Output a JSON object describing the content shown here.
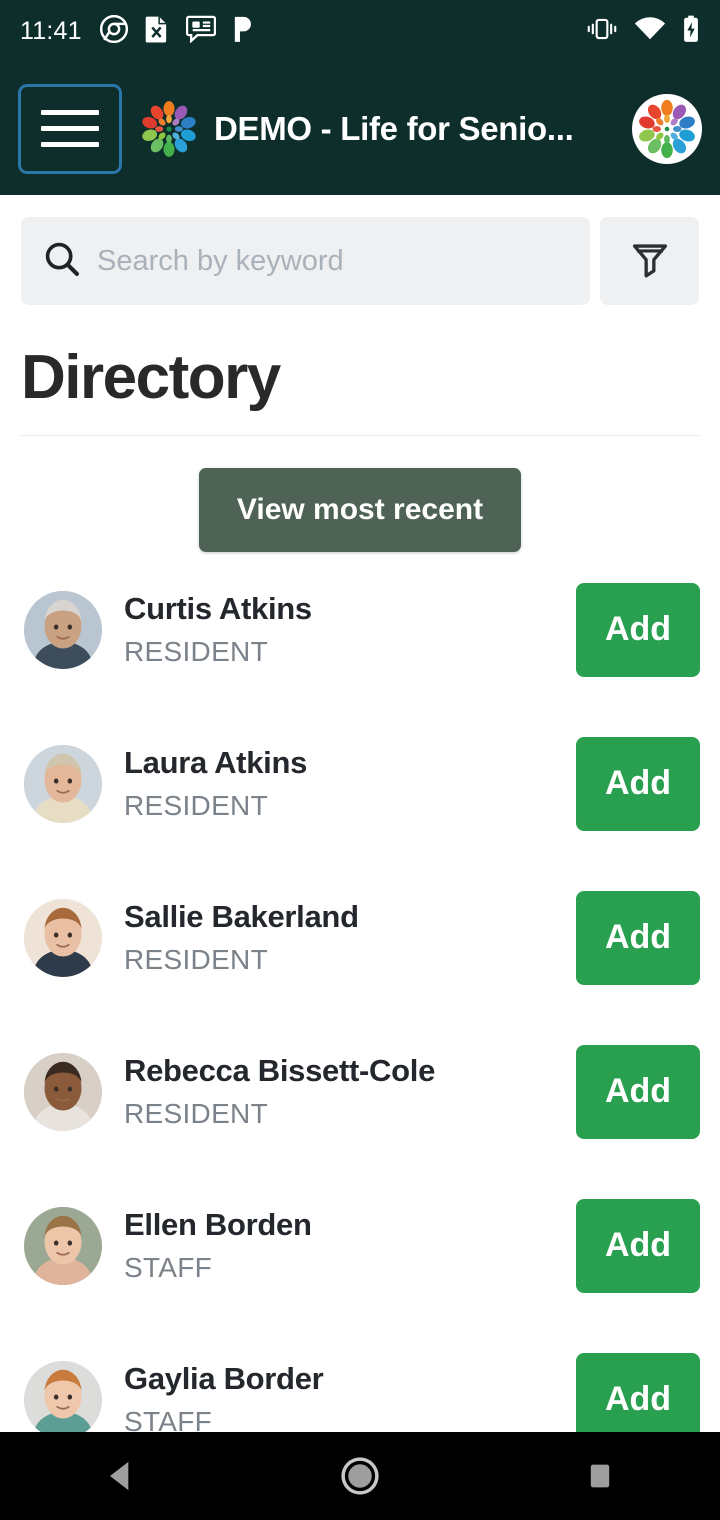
{
  "status_bar": {
    "clock": "11:41",
    "left_icons": [
      "chrome-icon",
      "spreadsheet-icon",
      "message-icon",
      "pandora-icon"
    ],
    "right_icons": [
      "vibrate-icon",
      "wifi-icon",
      "battery-charging-icon"
    ],
    "background_color": "#0d2e2b"
  },
  "app_bar": {
    "menu_label": "Open navigation menu",
    "title": "DEMO - Life for Senio...",
    "logo_name": "app-logo",
    "avatar_name": "user-avatar",
    "focus_ring_color": "#2b76a8",
    "background_color": "#0d2e2b"
  },
  "search": {
    "placeholder": "Search by keyword",
    "value": "",
    "icon": "search-icon",
    "filter_icon": "filter-funnel-icon",
    "field_background": "#eef0f1"
  },
  "page": {
    "title": "Directory"
  },
  "actions": {
    "view_most_recent": "View most recent",
    "view_most_recent_color": "#4e6355",
    "add_label": "Add",
    "add_color": "#28a04f"
  },
  "directory": [
    {
      "name": "Curtis Atkins",
      "role": "RESIDENT",
      "action": "Add",
      "avatar": "photo-curtis-atkins",
      "avatar_bg": "#b9c6d2",
      "skin": "#c9a183",
      "hair": "#d8d5d0",
      "shirt": "#3d4d5c"
    },
    {
      "name": "Laura Atkins",
      "role": "RESIDENT",
      "action": "Add",
      "avatar": "photo-laura-atkins",
      "avatar_bg": "#cdd6dc",
      "skin": "#e3b79a",
      "hair": "#cfc6ad",
      "shirt": "#e7dcc4"
    },
    {
      "name": "Sallie Bakerland",
      "role": "RESIDENT",
      "action": "Add",
      "avatar": "photo-sallie-bakerland",
      "avatar_bg": "#efe2d6",
      "skin": "#e9c0a4",
      "hair": "#a86a3c",
      "shirt": "#2d3b4a"
    },
    {
      "name": "Rebecca Bissett-Cole",
      "role": "RESIDENT",
      "action": "Add",
      "avatar": "photo-rebecca-bissett-cole",
      "avatar_bg": "#d8cfc6",
      "skin": "#8a5a3b",
      "hair": "#3b2a21",
      "shirt": "#e8e3dd"
    },
    {
      "name": "Ellen Borden",
      "role": "STAFF",
      "action": "Add",
      "avatar": "photo-ellen-borden",
      "avatar_bg": "#9aa894",
      "skin": "#edc5a8",
      "hair": "#9a7447",
      "shirt": "#e0b49a"
    },
    {
      "name": "Gaylia Border",
      "role": "STAFF",
      "action": "Add",
      "avatar": "photo-gaylia-border",
      "avatar_bg": "#dcdcda",
      "skin": "#efc8ab",
      "hair": "#c87b3c",
      "shirt": "#5c9e93"
    }
  ],
  "nav_bar": {
    "back_label": "Back",
    "home_label": "Home",
    "recents_label": "Recent apps",
    "background_color": "#000000"
  }
}
